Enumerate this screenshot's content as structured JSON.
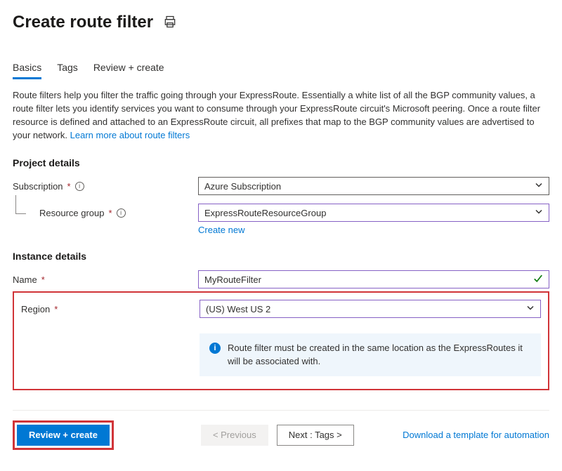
{
  "title": "Create route filter",
  "tabs": {
    "basics": "Basics",
    "tags": "Tags",
    "review": "Review + create"
  },
  "intro": "Route filters help you filter the traffic going through your ExpressRoute. Essentially a white list of all the BGP community values, a route filter lets you identify services you want to consume through your ExpressRoute circuit's Microsoft peering. Once a route filter resource is defined and attached to an ExpressRoute circuit, all prefixes that map to the BGP community values are advertised to your network. ",
  "learn_link": "Learn more about route filters",
  "project_details": "Project details",
  "subscription_label": "Subscription",
  "subscription_value": "Azure Subscription",
  "rg_label": "Resource group",
  "rg_value": "ExpressRouteResourceGroup",
  "create_new": "Create new",
  "instance_details": "Instance details",
  "name_label": "Name",
  "name_value": "MyRouteFilter",
  "region_label": "Region",
  "region_value": "(US) West US 2",
  "info_text": "Route filter must be created in the same location as the ExpressRoutes it will be associated with.",
  "review_btn": "Review + create",
  "prev_btn": "< Previous",
  "next_btn": "Next : Tags >",
  "download_link": "Download a template for automation"
}
